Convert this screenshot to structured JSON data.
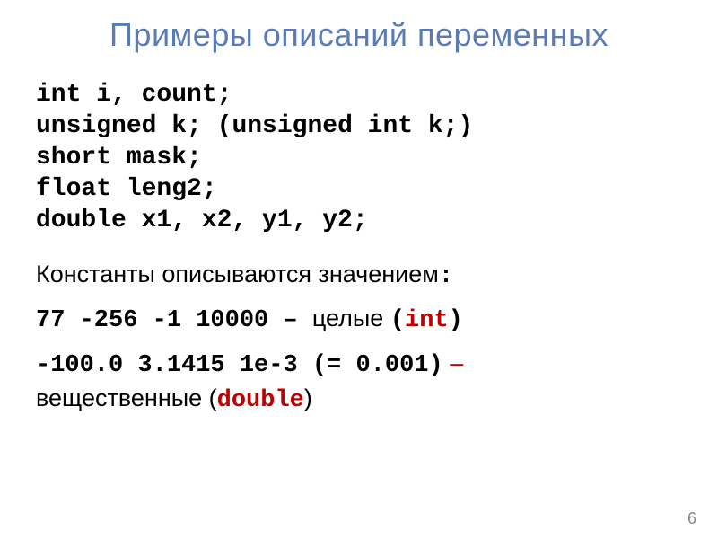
{
  "title": "Примеры описаний переменных",
  "code": {
    "line1": "int i, count;",
    "line2a": "unsigned k; ",
    "line2b": "(unsigned int k;)",
    "line3": "short mask;",
    "line4": "float leng2;",
    "line5": "double x1, x2, y1, y2;"
  },
  "constants_intro": "Константы описываются значением",
  "constants_intro_colon": ":",
  "int_line": {
    "numbers": "77  -256  -1  10000 ",
    "dash": "– ",
    "label": "целые ",
    "paren_open": "(",
    "type": "int",
    "paren_close": ")"
  },
  "double_line": {
    "numbers": "-100.0  3.1415  1e-3 (= 0.001)",
    "dash": " –",
    "label": "вещественные ",
    "paren_open": "(",
    "type": "double",
    "paren_close": ")"
  },
  "page_number": "6"
}
